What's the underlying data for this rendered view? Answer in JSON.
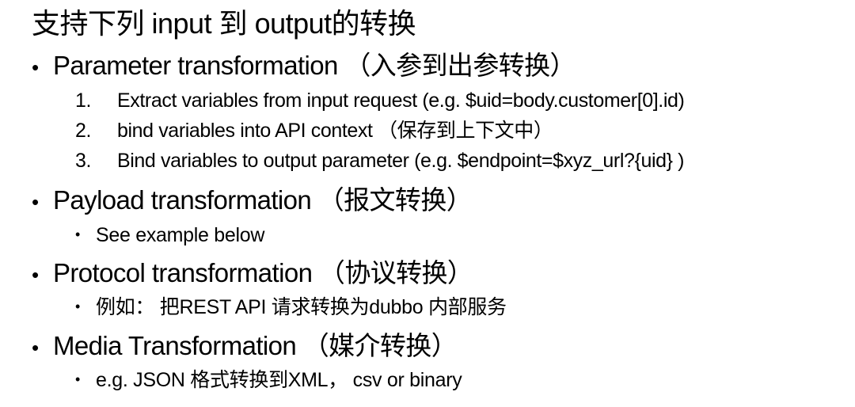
{
  "title": "支持下列 input 到 output的转换",
  "bullet_glyph": "•",
  "sections": [
    {
      "heading": "Parameter transformation （入参到出参转换）",
      "numbered": [
        {
          "n": "1.",
          "text": "Extract variables from input request (e.g. $uid=body.customer[0].id)"
        },
        {
          "n": "2.",
          "text": "bind variables into API context （保存到上下文中）"
        },
        {
          "n": "3.",
          "text": "Bind variables to output parameter (e.g. $endpoint=$xyz_url?{uid} )"
        }
      ]
    },
    {
      "heading": "Payload transformation （报文转换）",
      "sub": [
        "See example below"
      ]
    },
    {
      "heading": "Protocol transformation （协议转换）",
      "sub": [
        "例如： 把REST API 请求转换为dubbo 内部服务"
      ]
    },
    {
      "heading": "Media Transformation （媒介转换）",
      "sub": [
        "e.g. JSON 格式转换到XML， csv or binary"
      ]
    }
  ]
}
